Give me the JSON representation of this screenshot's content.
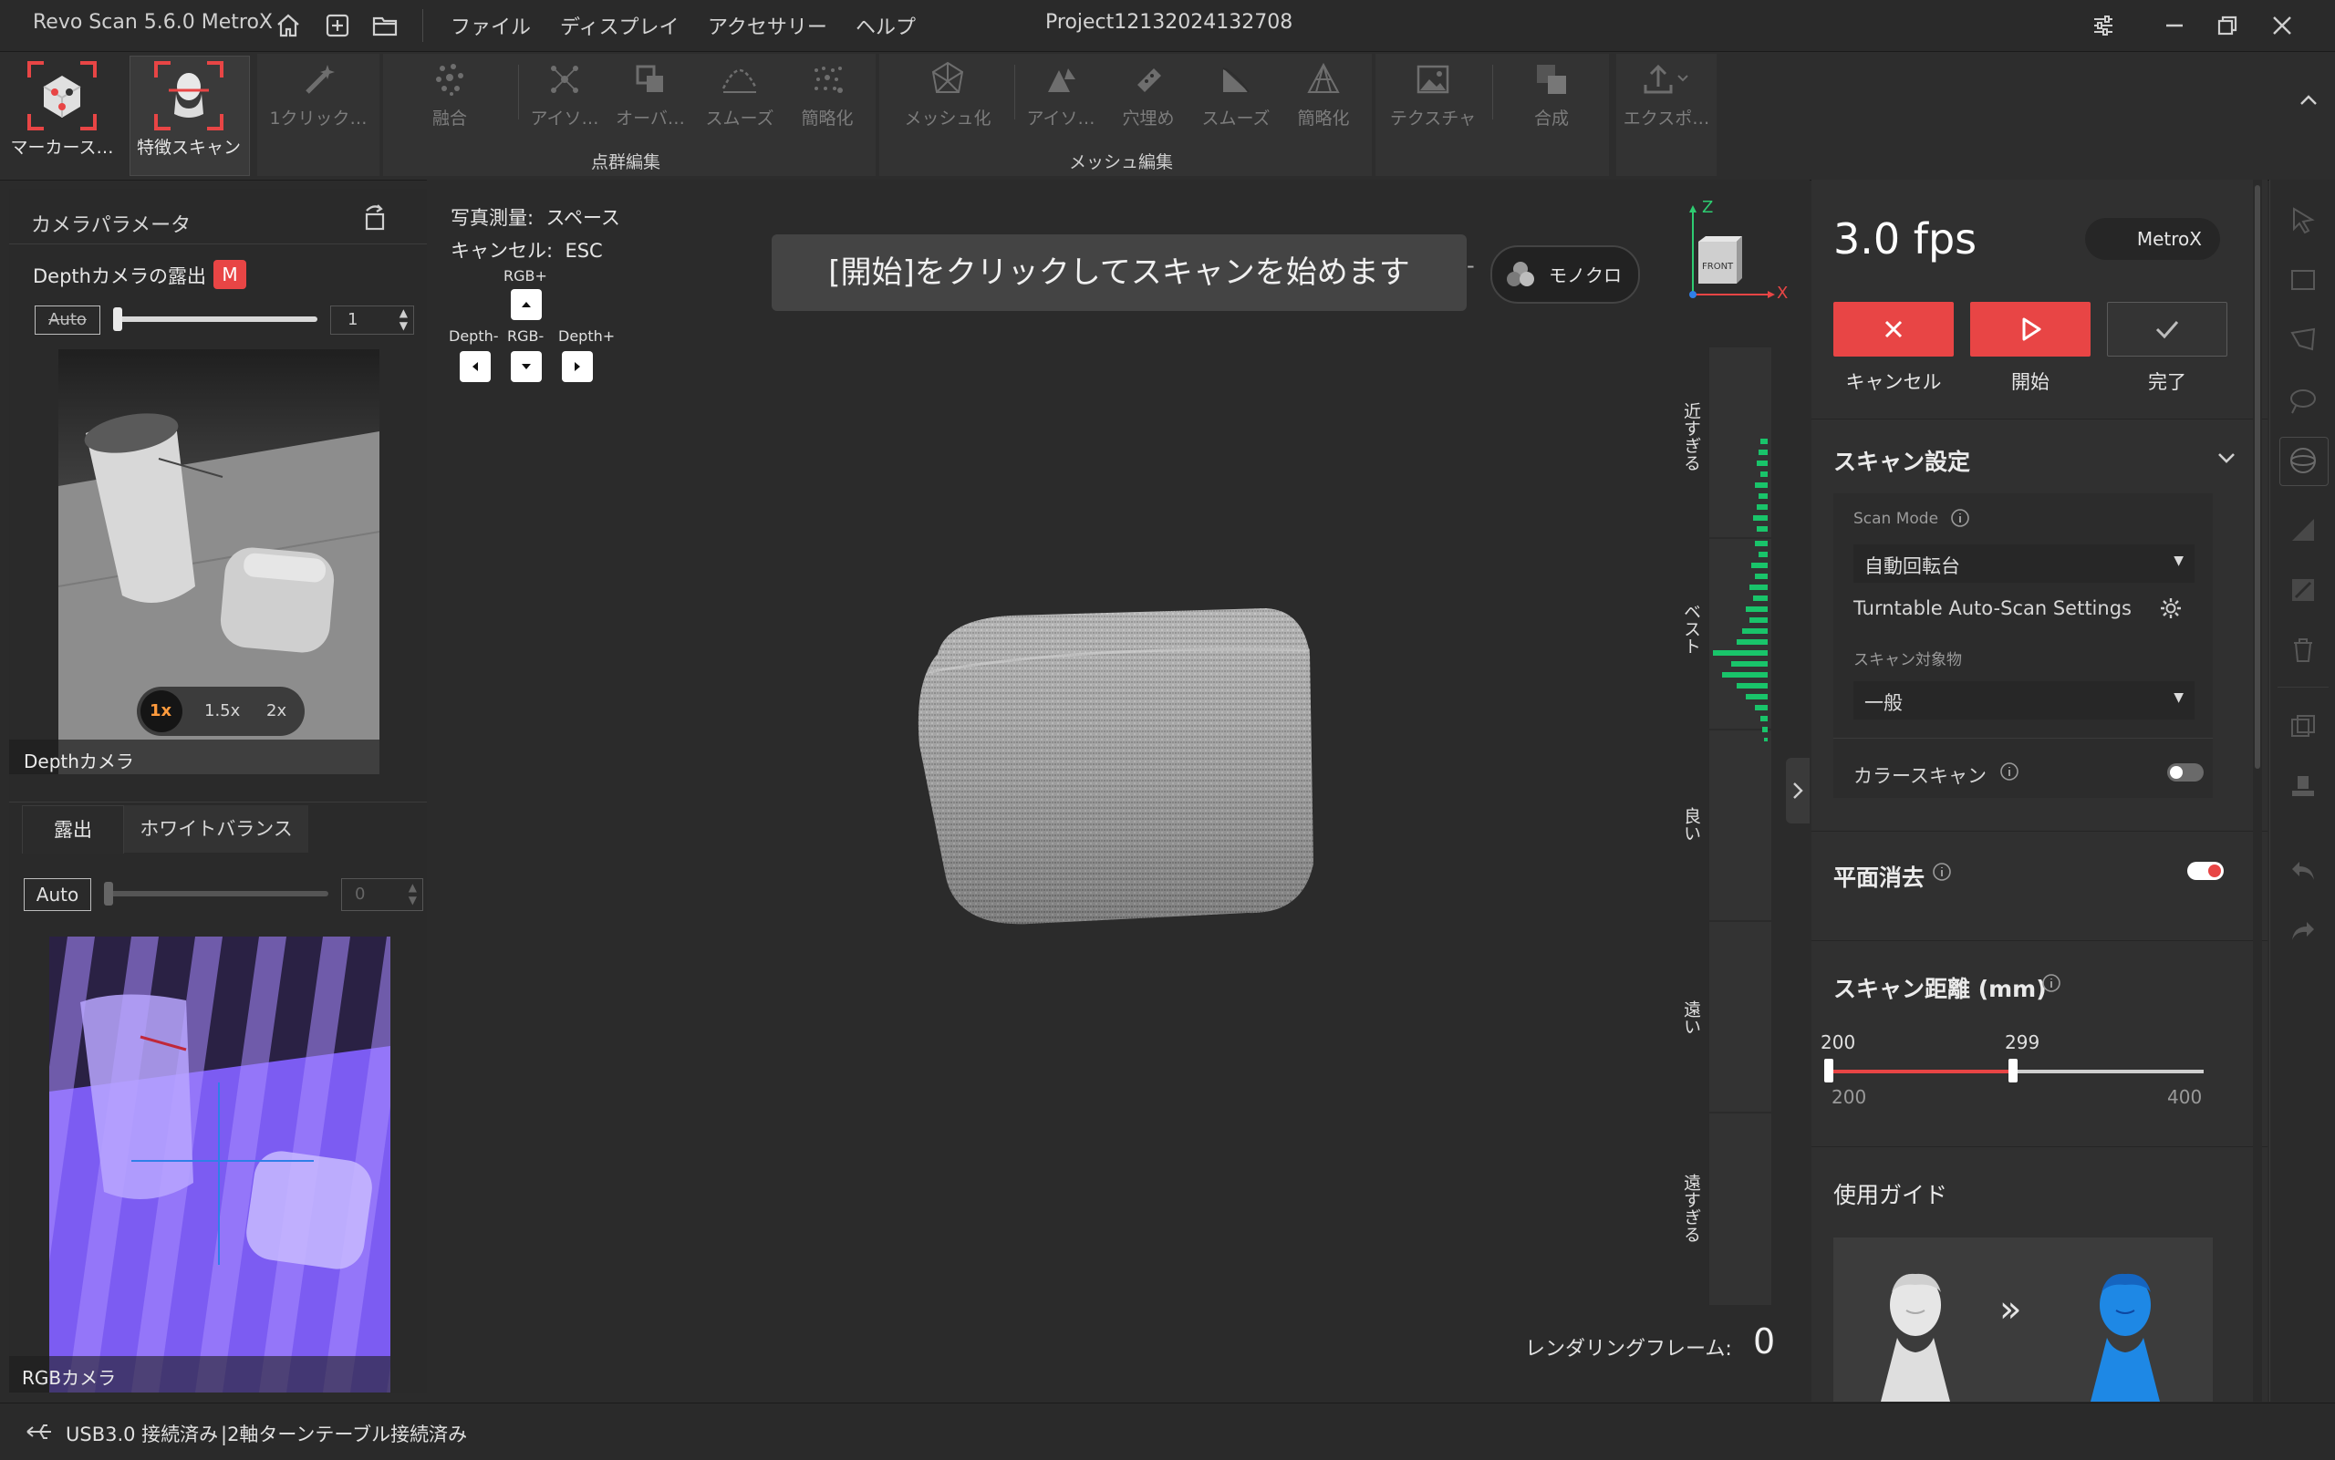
{
  "app": {
    "title": "Revo Scan 5.6.0 MetroX",
    "project": "Project12132024132708"
  },
  "menu": [
    "ファイル",
    "ディスプレイ",
    "アクセサリー",
    "ヘルプ"
  ],
  "toolbar": {
    "marker_scan": "マーカース…",
    "feature_scan": "特徴スキャン",
    "one_click": "1クリック…",
    "fuse": "融合",
    "iso1": "アイソ…",
    "overlap": "オーバ…",
    "smooth1": "スムーズ",
    "simplify1": "簡略化",
    "mesh": "メッシュ化",
    "iso2": "アイソ…",
    "fill_holes": "穴埋め",
    "smooth2": "スムーズ",
    "simplify2": "簡略化",
    "texture": "テクスチャ",
    "merge": "合成",
    "export": "エクスポ…",
    "group_pointcloud": "点群編集",
    "group_mesh": "メッシュ編集"
  },
  "left": {
    "camera_params": "カメラパラメータ",
    "depth_exposure": "Depthカメラの露出",
    "m_badge": "M",
    "auto": "Auto",
    "depth_value": "1",
    "zoom": [
      "1x",
      "1.5x",
      "2x"
    ],
    "depth_camera_label": "Depthカメラ",
    "tabs": [
      "露出",
      "ホワイトバランス"
    ],
    "rgb_auto": "Auto",
    "rgb_value": "0",
    "rgb_camera_label": "RGBカメラ"
  },
  "viewport": {
    "shortcut1_label": "写真測量:",
    "shortcut1_value": "スペース",
    "shortcut2_label": "キャンセル:",
    "shortcut2_value": "ESC",
    "rgb_plus": "RGB+",
    "depth_minus": "Depth-",
    "rgb_minus": "RGB-",
    "depth_plus": "Depth+",
    "banner": "[開始]をクリックしてスキャンを始めます",
    "mono": "モノクロ",
    "front": "FRONT",
    "axis_z": "Z",
    "axis_x": "X",
    "distance_labels": [
      "近すぎる",
      "ベスト",
      "良い",
      "遠い",
      "遠すぎる"
    ],
    "render_frame_label": "レンダリングフレーム:",
    "render_frame_value": "0"
  },
  "right": {
    "fps": "3.0 fps",
    "device": "MetroX",
    "cancel": "キャンセル",
    "start": "開始",
    "done": "完了",
    "scan_settings": "スキャン設定",
    "scan_mode_label": "Scan Mode",
    "scan_mode_value": "自動回転台",
    "turntable_settings": "Turntable Auto-Scan Settings",
    "scan_object_label": "スキャン対象物",
    "scan_object_value": "一般",
    "color_scan": "カラースキャン",
    "plane_removal": "平面消去",
    "scan_distance": "スキャン距離 (mm)",
    "dist_min": "200",
    "dist_max": "400",
    "dist_low": "200",
    "dist_high": "299",
    "guide": "使用ガイド",
    "arrow": "»"
  },
  "status": {
    "usb": "USB3.0 接続済み",
    "turntable": "|2軸ターンテーブル接続済み"
  },
  "colors": {
    "accent": "#e84545",
    "green": "#19c46a",
    "panel": "#303030",
    "bg": "#2b2b2b"
  }
}
